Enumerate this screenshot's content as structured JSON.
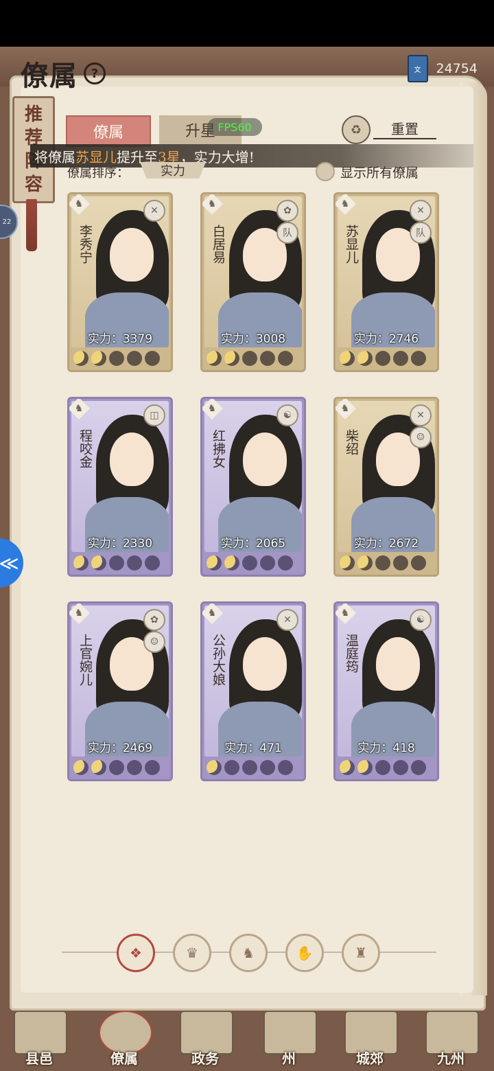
{
  "header": {
    "title": "僚属",
    "help": "?",
    "currency_value": "24754",
    "currency_icon_label": "文"
  },
  "side_tag": {
    "label_chars": [
      "推",
      "荐",
      "阵",
      "容"
    ]
  },
  "edge_bubble": "22",
  "tabs": [
    {
      "label": "僚属",
      "active": true
    },
    {
      "label": "升星",
      "active": false
    }
  ],
  "fps": "FPS60",
  "reset": {
    "label": "重置"
  },
  "banner": {
    "prefix": "将僚属",
    "name": "苏显儿",
    "mid": "提升至",
    "star": "3星",
    "suffix": "，实力大增!"
  },
  "sort": {
    "label": "僚属排序：",
    "value": "实力"
  },
  "show_all": "显示所有僚属",
  "cards": [
    {
      "name": "李秀宁",
      "power": "实力：3379",
      "stars": 2,
      "theme": "gold",
      "skill": "✕",
      "skill2": ""
    },
    {
      "name": "白居易",
      "power": "实力：3008",
      "stars": 2,
      "theme": "gold",
      "skill": "✿",
      "skill2": "队"
    },
    {
      "name": "苏显儿",
      "power": "实力：2746",
      "stars": 2,
      "theme": "gold",
      "skill": "✕",
      "skill2": "队"
    },
    {
      "name": "程咬金",
      "power": "实力：2330",
      "stars": 2,
      "theme": "purple",
      "skill": "◫",
      "skill2": ""
    },
    {
      "name": "红拂女",
      "power": "实力：2065",
      "stars": 2,
      "theme": "purple",
      "skill": "☯",
      "skill2": ""
    },
    {
      "name": "柴绍",
      "power": "实力：2672",
      "stars": 2,
      "theme": "gold",
      "skill": "✕",
      "skill2": "☺"
    },
    {
      "name": "上官婉儿",
      "power": "实力：2469",
      "stars": 2,
      "theme": "purple",
      "skill": "✿",
      "skill2": "☺"
    },
    {
      "name": "公孙大娘",
      "power": "实力：471",
      "stars": 1,
      "theme": "purple",
      "skill": "✕",
      "skill2": ""
    },
    {
      "name": "温庭筠",
      "power": "实力：418",
      "stars": 2,
      "theme": "purple",
      "skill": "☯",
      "skill2": ""
    }
  ],
  "filters": [
    "❖",
    "♛",
    "♞",
    "✋",
    "♜"
  ],
  "nav": [
    {
      "label": "县邑",
      "active": false
    },
    {
      "label": "僚属",
      "active": true
    },
    {
      "label": "政务",
      "active": false
    },
    {
      "label": "州",
      "active": false
    },
    {
      "label": "城郊",
      "active": false
    },
    {
      "label": "九州",
      "active": false
    }
  ]
}
